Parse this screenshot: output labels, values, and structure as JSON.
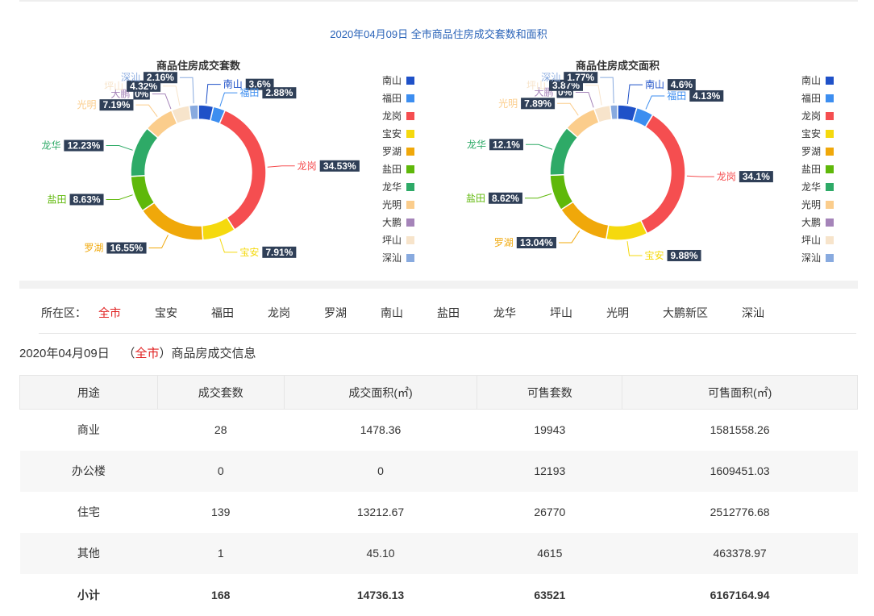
{
  "page": {
    "main_title": "2020年04月09日 全市商品住房成交套数和面积"
  },
  "legend": [
    {
      "name": "南山",
      "color": "#1f51c8"
    },
    {
      "name": "福田",
      "color": "#3d8ef0"
    },
    {
      "name": "龙岗",
      "color": "#f54e50"
    },
    {
      "name": "宝安",
      "color": "#f5d90e"
    },
    {
      "name": "罗湖",
      "color": "#f0a80a"
    },
    {
      "name": "盐田",
      "color": "#5fb80a"
    },
    {
      "name": "龙华",
      "color": "#2eaa67"
    },
    {
      "name": "光明",
      "color": "#fbcd8c"
    },
    {
      "name": "大鹏",
      "color": "#a584b9"
    },
    {
      "name": "坪山",
      "color": "#f7e4cb"
    },
    {
      "name": "深汕",
      "color": "#88aadf"
    }
  ],
  "chart_data": [
    {
      "type": "pie",
      "title": "商品住房成交套数",
      "labels": [
        "南山",
        "福田",
        "龙岗",
        "宝安",
        "罗湖",
        "盐田",
        "龙华",
        "光明",
        "大鹏",
        "坪山",
        "深汕"
      ],
      "values": [
        3.6,
        2.88,
        34.53,
        7.91,
        16.55,
        8.63,
        12.23,
        7.19,
        0,
        4.32,
        2.16
      ],
      "value_labels": [
        "3.6%",
        "2.88%",
        "34.53%",
        "7.91%",
        "16.55%",
        "8.63%",
        "12.23%",
        "7.19%",
        "0%",
        "4.32%",
        "2.16%"
      ]
    },
    {
      "type": "pie",
      "title": "商品住房成交面积",
      "labels": [
        "南山",
        "福田",
        "龙岗",
        "宝安",
        "罗湖",
        "盐田",
        "龙华",
        "光明",
        "大鹏",
        "坪山",
        "深汕"
      ],
      "values": [
        4.6,
        4.13,
        34.1,
        9.88,
        13.04,
        8.62,
        12.1,
        7.89,
        0,
        3.87,
        1.77
      ],
      "value_labels": [
        "4.6%",
        "4.13%",
        "34.1%",
        "9.88%",
        "13.04%",
        "8.62%",
        "12.1%",
        "7.89%",
        "0%",
        "3.87%",
        "1.77%"
      ]
    }
  ],
  "filter": {
    "label": "所在区：",
    "items": [
      "全市",
      "宝安",
      "福田",
      "龙岗",
      "罗湖",
      "南山",
      "盐田",
      "龙华",
      "坪山",
      "光明",
      "大鹏新区",
      "深汕"
    ],
    "active": "全市"
  },
  "info": {
    "date": "2020年04月09日",
    "open": "（",
    "district": "全市",
    "close": "）",
    "suffix": "商品房成交信息"
  },
  "table": {
    "headers": [
      "用途",
      "成交套数",
      "成交面积(㎡)",
      "可售套数",
      "可售面积(㎡)"
    ],
    "rows": [
      [
        "商业",
        "28",
        "1478.36",
        "19943",
        "1581558.26"
      ],
      [
        "办公楼",
        "0",
        "0",
        "12193",
        "1609451.03"
      ],
      [
        "住宅",
        "139",
        "13212.67",
        "26770",
        "2512776.68"
      ],
      [
        "其他",
        "1",
        "45.10",
        "4615",
        "463378.97"
      ]
    ],
    "total": [
      "小计",
      "168",
      "14736.13",
      "63521",
      "6167164.94"
    ]
  }
}
